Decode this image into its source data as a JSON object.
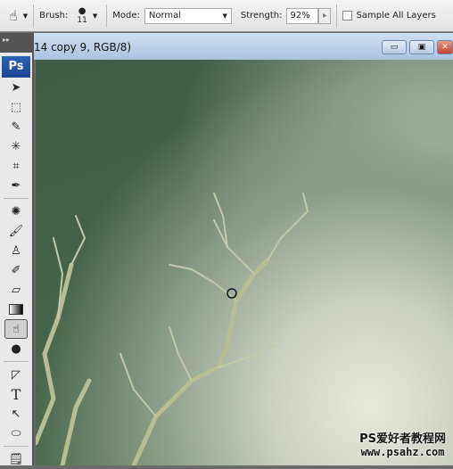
{
  "options_bar": {
    "tool_icon": "smudge-tool-icon",
    "brush_label": "Brush:",
    "brush_size": "11",
    "mode_label": "Mode:",
    "mode_value": "Normal",
    "strength_label": "Strength:",
    "strength_value": "92%",
    "sample_all_layers_label": "Sample All Layers",
    "sample_all_layers_checked": false
  },
  "document": {
    "title": "14 copy 9, RGB/8)"
  },
  "toolbox": {
    "collapse": "▸▸",
    "logo": "Ps",
    "active_tool": "smudge"
  },
  "watermark": {
    "line1": "PS爱好者教程网",
    "line2": "www.psahz.com"
  }
}
